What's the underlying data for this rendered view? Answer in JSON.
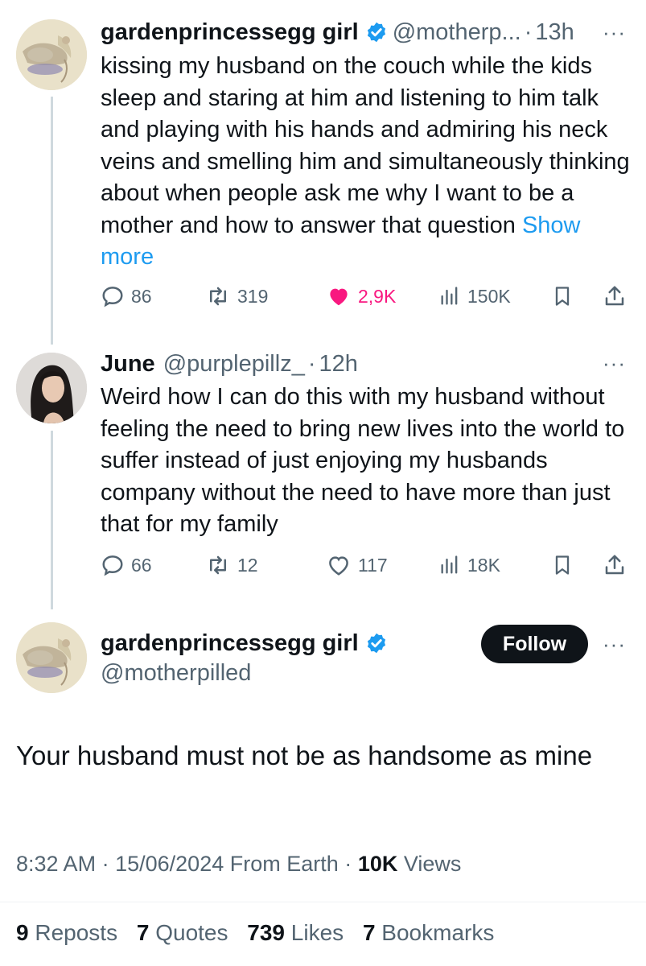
{
  "colors": {
    "accent": "#1d9bf0",
    "like": "#f91880",
    "text": "#0f1419",
    "muted": "#536471"
  },
  "post1": {
    "name": "gardenprincessegg girl",
    "handle": "@motherp...",
    "separator": "·",
    "time": "13h",
    "more": "···",
    "text": "kissing my husband on the couch while the kids sleep and staring at him and listening to him talk and playing with his hands and admiring his neck veins and smelling him and simultaneously thinking about when people ask me why I want to be a mother and how to answer that question",
    "show_more": "Show more",
    "replies": "86",
    "reposts": "319",
    "likes": "2,9K",
    "views": "150K"
  },
  "post2": {
    "name": "June",
    "handle": "@purplepillz_",
    "separator": "·",
    "time": "12h",
    "more": "···",
    "text": "Weird how I can do this with my husband without feeling the need to bring new lives into the world to suffer instead of just enjoying my husbands company without the need to have more than just that for my family",
    "replies": "66",
    "reposts": "12",
    "likes": "117",
    "views": "18K"
  },
  "main": {
    "name": "gardenprincessegg girl",
    "handle": "@motherpilled",
    "follow_label": "Follow",
    "more": "···",
    "text": "Your husband must not be as handsome as mine",
    "time": "8:32 AM",
    "separator": "·",
    "date": "15/06/2024",
    "source": "From Earth",
    "views_count": "10K",
    "views_label": "Views",
    "reposts_count": "9",
    "reposts_label": "Reposts",
    "quotes_count": "7",
    "quotes_label": "Quotes",
    "likes_count": "739",
    "likes_label": "Likes",
    "bookmarks_count": "7",
    "bookmarks_label": "Bookmarks"
  }
}
